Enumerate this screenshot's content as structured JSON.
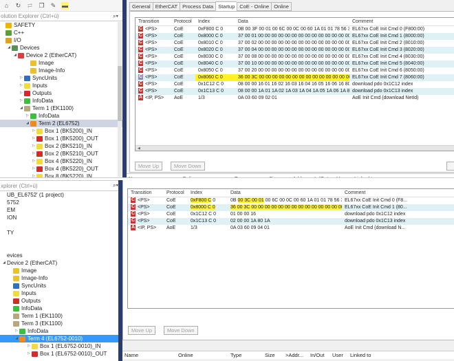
{
  "top": {
    "toolbar_icons": [
      "home-icon",
      "history-icon",
      "refresh-icon",
      "copy-icon",
      "wrench-icon",
      "minus-icon"
    ],
    "search_placeholder": "olution Explorer (Ctrl+ü)",
    "tree": [
      {
        "label": "SAFETY",
        "icon": "safety",
        "indent": 0,
        "exp": ""
      },
      {
        "label": "C++",
        "icon": "cpp",
        "indent": 0,
        "exp": ""
      },
      {
        "label": "I/O",
        "icon": "io",
        "indent": 0,
        "exp": ""
      },
      {
        "label": "Devices",
        "icon": "devices",
        "indent": 1,
        "exp": "◢"
      },
      {
        "label": "Device 2 (EtherCAT)",
        "icon": "device",
        "indent": 2,
        "exp": "◢"
      },
      {
        "label": "Image",
        "icon": "image",
        "indent": 4,
        "exp": ""
      },
      {
        "label": "Image-Info",
        "icon": "image",
        "indent": 4,
        "exp": ""
      },
      {
        "label": "SyncUnits",
        "icon": "sync",
        "indent": 3,
        "exp": "▷"
      },
      {
        "label": "Inputs",
        "icon": "in",
        "indent": 3,
        "exp": "▷"
      },
      {
        "label": "Outputs",
        "icon": "out",
        "indent": 3,
        "exp": "▷"
      },
      {
        "label": "InfoData",
        "icon": "info",
        "indent": 3,
        "exp": "▷"
      },
      {
        "label": "Term 1 (EK1100)",
        "icon": "term",
        "indent": 3,
        "exp": "◢"
      },
      {
        "label": "InfoData",
        "icon": "info",
        "indent": 4,
        "exp": "▷"
      },
      {
        "label": "Term 2 (EL6752)",
        "icon": "term2",
        "indent": 4,
        "exp": "◢",
        "selected": true
      },
      {
        "label": "Box 1  (BK5200)_IN",
        "icon": "in",
        "indent": 5,
        "exp": "▷"
      },
      {
        "label": "Box 1  (BK5200)_OUT",
        "icon": "out",
        "indent": 5,
        "exp": "▷"
      },
      {
        "label": "Box 2  (BK5210)_IN",
        "icon": "in",
        "indent": 5,
        "exp": "▷"
      },
      {
        "label": "Box 2  (BK5210)_OUT",
        "icon": "out",
        "indent": 5,
        "exp": "▷"
      },
      {
        "label": "Box 4  (BK5220)_IN",
        "icon": "in",
        "indent": 5,
        "exp": "▷"
      },
      {
        "label": "Box 4  (BK5220)_OUT",
        "icon": "out",
        "indent": 5,
        "exp": "▷"
      },
      {
        "label": "Box 8  (BK5220)_IN",
        "icon": "in",
        "indent": 5,
        "exp": "▷"
      }
    ],
    "tabs": [
      "General",
      "EtherCAT",
      "Process Data",
      "Startup",
      "CoE - Online",
      "Online"
    ],
    "active_tab": "Startup",
    "columns": [
      "Transition",
      "Protocol",
      "Index",
      "Data",
      "Comment"
    ],
    "rows": [
      {
        "t": "C",
        "tr": "<PS>",
        "p": "CoE",
        "i": "0xF800 C 0",
        "d": "0B 00 3F 00 01 00 6C 00 0C 00 60 1A 01 01 78 56 34 12 00 00 00 00 0...",
        "c": "EL67xx CoE Init Cmd 0 (F800:00)"
      },
      {
        "t": "C",
        "tr": "<PS>",
        "p": "CoE",
        "i": "0x8000 C 0",
        "d": "37 00 01 00 00 00 00 00 00 00 00 00 00 00 00 00 00 00 00 00 0C 00 0...",
        "c": "EL67xx CoE Init Cmd 1 (8000:00)"
      },
      {
        "t": "C",
        "tr": "<PS>",
        "p": "CoE",
        "i": "0x8010 C 0",
        "d": "37 00 02 00 00 00 00 00 00 00 00 00 00 00 00 00 00 00 00 00 0C 00 0...",
        "c": "EL67xx CoE Init Cmd 2 (8010:00)"
      },
      {
        "t": "C",
        "tr": "<PS>",
        "p": "CoE",
        "i": "0x8020 C 0",
        "d": "37 00 04 00 00 00 00 00 00 00 00 00 00 00 00 00 00 00 00 00 0C 00 0...",
        "c": "EL67xx CoE Init Cmd 3 (8020:00)"
      },
      {
        "t": "C",
        "tr": "<PS>",
        "p": "CoE",
        "i": "0x8030 C 0",
        "d": "37 00 08 00 00 00 00 00 00 00 00 00 00 00 00 00 00 00 00 00 0C 00 0...",
        "c": "EL67xx CoE Init Cmd 4 (8030:00)"
      },
      {
        "t": "C",
        "tr": "<PS>",
        "p": "CoE",
        "i": "0x8040 C 0",
        "d": "37 00 10 00 00 00 00 00 00 00 00 00 00 00 00 00 00 00 00 00 0C 00 0...",
        "c": "EL67xx CoE Init Cmd 5 (8040:00)"
      },
      {
        "t": "C",
        "tr": "<PS>",
        "p": "CoE",
        "i": "0x8050 C 0",
        "d": "37 00 20 00 00 00 00 00 00 00 00 00 00 00 00 00 00 00 00 00 0C 00 0...",
        "c": "EL67xx CoE Init Cmd 6 (8050:00)"
      },
      {
        "t": "C",
        "tr": "<PS>",
        "p": "CoE",
        "i": "0x8060 C 0",
        "d": "36 00 3C 00 00 00 00 00 00 00 00 00 00 00 00 00 00 00 00 00 0C 00 0...",
        "c": "EL67xx CoE Init Cmd 7 (8060:00)",
        "hl": true,
        "grey": true
      },
      {
        "t": "C",
        "tr": "<PS>",
        "p": "CoE",
        "i": "0x1C12 C 0",
        "d": "08 00 00 16 01 16 02 16 03 16 04 16 05 16 06 16 80 16",
        "c": "download pdo 0x1C12 index"
      },
      {
        "t": "C",
        "tr": "<PS>",
        "p": "CoE",
        "i": "0x1C13 C 0",
        "d": "08 00 00 1A 01 1A 02 1A 03 1A 04 1A 05 1A 06 1A 80 1A",
        "c": "download pdo 0x1C13 index"
      },
      {
        "t": "A",
        "tr": "<IP, PS>",
        "p": "AoE",
        "i": "1/3",
        "d": "0A 03 60 09 02 01",
        "c": "AoE Init Cmd (download NetId)"
      }
    ],
    "move_up": "Move Up",
    "move_down": "Move Down",
    "bottom_cols": [
      "Name",
      "Online",
      "Type",
      "Size",
      ">Addr...",
      "In/Out",
      "User ID",
      "Linked to"
    ]
  },
  "bottom": {
    "search_placeholder": "xplorer (Ctrl+ü)",
    "tree": [
      {
        "label": "UB_EL6752' (1 project)",
        "icon": "",
        "indent": 0,
        "exp": ""
      },
      {
        "label": "5752",
        "icon": "",
        "indent": 0,
        "exp": ""
      },
      {
        "label": "EM",
        "icon": "",
        "indent": 0,
        "exp": ""
      },
      {
        "label": "ION",
        "icon": "",
        "indent": 0,
        "exp": ""
      },
      {
        "label": "",
        "icon": "",
        "indent": 0,
        "exp": ""
      },
      {
        "label": "TY",
        "icon": "",
        "indent": 0,
        "exp": ""
      },
      {
        "label": "",
        "icon": "",
        "indent": 0,
        "exp": ""
      },
      {
        "label": "",
        "icon": "",
        "indent": 0,
        "exp": ""
      },
      {
        "label": "evices",
        "icon": "",
        "indent": 0,
        "exp": ""
      },
      {
        "label": "Device 2 (EtherCAT)",
        "icon": "",
        "indent": 0,
        "exp": "◢"
      },
      {
        "label": "Image",
        "icon": "image",
        "indent": 1,
        "exp": ""
      },
      {
        "label": "Image-Info",
        "icon": "image",
        "indent": 1,
        "exp": ""
      },
      {
        "label": "SyncUnits",
        "icon": "sync",
        "indent": 1,
        "exp": ""
      },
      {
        "label": "Inputs",
        "icon": "in",
        "indent": 1,
        "exp": ""
      },
      {
        "label": "Outputs",
        "icon": "out",
        "indent": 1,
        "exp": ""
      },
      {
        "label": "InfoData",
        "icon": "info",
        "indent": 1,
        "exp": ""
      },
      {
        "label": "Term 1 (EK1100)",
        "icon": "term",
        "indent": 1,
        "exp": ""
      },
      {
        "label": "Term 3 (EK1100)",
        "icon": "term",
        "indent": 1,
        "exp": ""
      },
      {
        "label": "InfoData",
        "icon": "info",
        "indent": 2,
        "exp": "▷"
      },
      {
        "label": "Term 4 (EL6752-0010)",
        "icon": "term2",
        "indent": 2,
        "exp": "◢",
        "selected": true
      },
      {
        "label": "Box 1 (EL6752-0010)_IN",
        "icon": "in",
        "indent": 4,
        "exp": "▷"
      },
      {
        "label": "Box 1 (EL6752-0010)_OUT",
        "icon": "out",
        "indent": 4,
        "exp": "▷"
      }
    ],
    "columns": [
      "Transition",
      "Protocol",
      "Index",
      "Data",
      "Comment"
    ],
    "rows": [
      {
        "t": "C",
        "tr": "<PS>",
        "p": "CoE",
        "i": "0xF800 C 0",
        "ihl": "0xF800 C",
        "irest": " 0",
        "d1": "0B ",
        "dhl": "00 3C 00 01",
        "d2": " 00 6C 00 0C 00 60 1A 01 01 78 56 34 12 00 00 ...",
        "c": "EL67xx CoE Init Cmd 0 (F8..."
      },
      {
        "t": "C",
        "tr": "<PS>",
        "p": "CoE",
        "i": "0x8000 C 0",
        "ihl": "0x8000 C 0",
        "irest": "",
        "d1": "",
        "dhl": "36 00 3C 00 00 00 00 00 00 00 00 00 00 00 00 00 00 00 00 00 0...",
        "d2": "",
        "c": "EL67xx CoE Init Cmd 1 (80..."
      },
      {
        "t": "C",
        "tr": "<PS>",
        "p": "CoE",
        "i": "0x1C12 C 0",
        "ihl": "",
        "irest": "0x1C12 C 0",
        "d1": "01 00 00 16",
        "dhl": "",
        "d2": "",
        "c": "download pdo 0x1C12 index"
      },
      {
        "t": "C",
        "tr": "<PS>",
        "p": "CoE",
        "i": "0x1C13 C 0",
        "ihl": "",
        "irest": "0x1C13 C 0",
        "d1": "02 00 00 1A 80 1A",
        "dhl": "",
        "d2": "",
        "c": "download pdo 0x1C13 index"
      },
      {
        "t": "A",
        "tr": "<IP, PS>",
        "p": "AoE",
        "i": "1/3",
        "ihl": "",
        "irest": "1/3",
        "d1": "0A 03 60 09 04 01",
        "dhl": "",
        "d2": "",
        "c": "AoE Init Cmd (download N..."
      }
    ],
    "move_up": "Move Up",
    "move_down": "Move Down",
    "bottom_cols": [
      "Name",
      "Online",
      "Type",
      "Size",
      ">Addr...",
      "In/Out",
      "User ID",
      "Linked to"
    ]
  }
}
